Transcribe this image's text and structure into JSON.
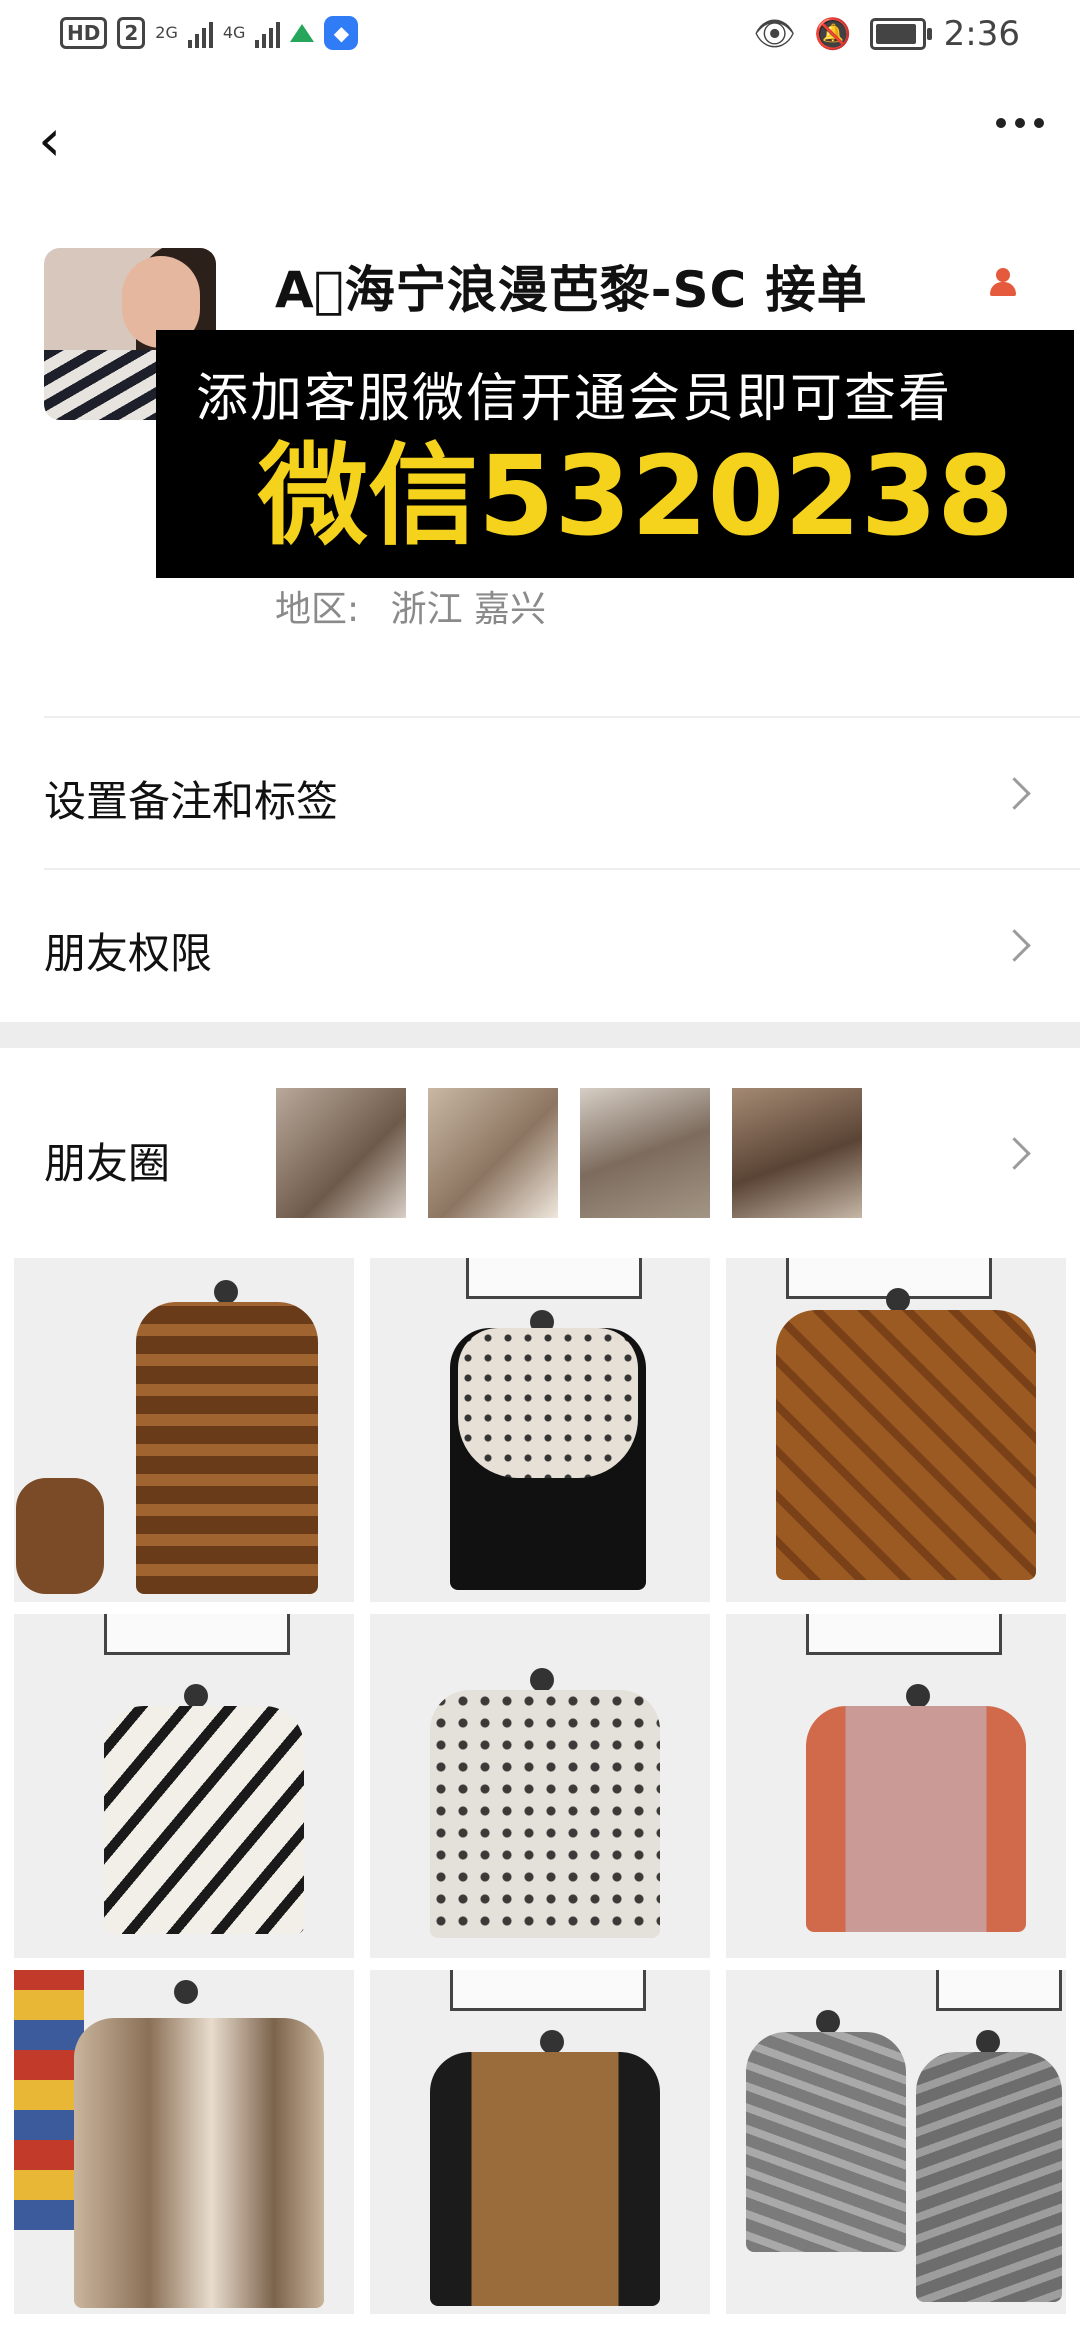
{
  "status_bar": {
    "hd_badge": "HD",
    "sim_badge": "2",
    "net1": "2G",
    "net2": "4G",
    "time": "2:36",
    "icons": [
      "eye-icon",
      "bell-off-icon",
      "battery-icon",
      "mountain-icon",
      "app-shield-icon"
    ]
  },
  "nav": {
    "back_icon": "chevron-left-icon",
    "more_icon": "more-dots-icon"
  },
  "profile": {
    "name": "A⃝海宁浪漫芭黎-SC 接单",
    "region_label": "地区:",
    "region_value": "浙江  嘉兴",
    "gender_icon": "person-icon"
  },
  "banner": {
    "line1": "添加客服微信开通会员即可查看",
    "line2": "微信5320238"
  },
  "menu": [
    {
      "label": "设置备注和标签"
    },
    {
      "label": "朋友权限"
    }
  ],
  "moments": {
    "label": "朋友圈"
  },
  "colors": {
    "accent": "#f5d31d",
    "banner_bg": "#000000",
    "divider": "#eeeeee",
    "section_gap": "#ededed"
  }
}
